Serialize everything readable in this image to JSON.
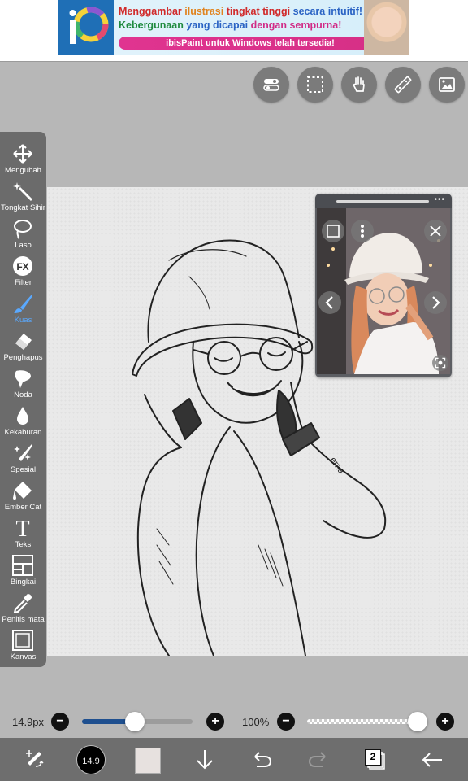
{
  "ad": {
    "line1_parts": [
      "Menggambar",
      " ilustrasi",
      " tingkat tinggi",
      " secara intuitif!"
    ],
    "line2_parts": [
      "Kebergunaan",
      " yang dicapai",
      " dengan sempurna!"
    ],
    "pill": "ibisPaint untuk Windows telah tersedia!",
    "logo_icon": "ibispaint-logo"
  },
  "top_tools": [
    {
      "name": "toggle-icon"
    },
    {
      "name": "selection-icon"
    },
    {
      "name": "hand-icon"
    },
    {
      "name": "ruler-icon"
    },
    {
      "name": "image-icon"
    }
  ],
  "left_toolbar": {
    "items": [
      {
        "label": "Mengubah",
        "icon": "move-icon"
      },
      {
        "label": "Tongkat Sihir",
        "icon": "magic-wand-icon"
      },
      {
        "label": "Laso",
        "icon": "lasso-icon"
      },
      {
        "label": "Filter",
        "icon": "fx-icon"
      },
      {
        "label": "Kuas",
        "icon": "brush-icon",
        "active": true
      },
      {
        "label": "Penghapus",
        "icon": "eraser-icon"
      },
      {
        "label": "Noda",
        "icon": "smudge-icon"
      },
      {
        "label": "Kekaburan",
        "icon": "blur-icon"
      },
      {
        "label": "Spesial",
        "icon": "special-icon"
      },
      {
        "label": "Ember Cat",
        "icon": "paint-bucket-icon"
      },
      {
        "label": "Teks",
        "icon": "text-icon"
      },
      {
        "label": "Bingkai",
        "icon": "frame-icon"
      },
      {
        "label": "Penitis mata",
        "icon": "eyedropper-icon"
      },
      {
        "label": "Kanvas",
        "icon": "canvas-icon"
      }
    ]
  },
  "canvas": {
    "signature": "erna"
  },
  "reference": {
    "more": "•••"
  },
  "brush": {
    "size_label": "14.9px",
    "size_fraction": 0.48,
    "opacity_label": "100%",
    "opacity_fraction": 1.0,
    "minus": "−",
    "plus": "+"
  },
  "bottom_bar": {
    "brush_size_display": "14.9",
    "layer_count": "2",
    "color_hex": "#e7e1df"
  },
  "colors": {
    "accent": "#5aa9ff",
    "toolbar": "#6b6b6b",
    "slider_blue": "#1e4f8f"
  }
}
